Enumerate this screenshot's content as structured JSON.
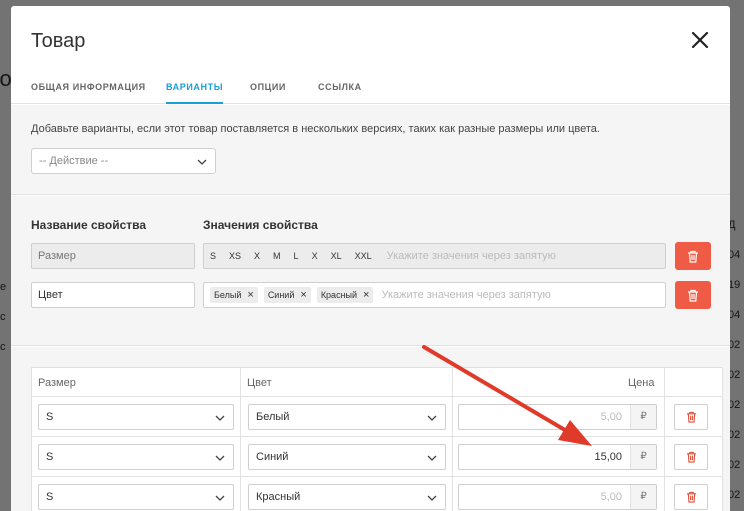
{
  "background": {
    "header_fragment": "го",
    "right_fragments": [
      "Д",
      "04",
      "19",
      "04",
      "02",
      "02",
      "02",
      "02",
      "02",
      "02"
    ],
    "left_fragments": [
      "е",
      "с",
      "с"
    ]
  },
  "modal": {
    "title": "Товар",
    "tabs": [
      {
        "label": "ОБЩАЯ ИНФОРМАЦИЯ",
        "active": false
      },
      {
        "label": "ВАРИАНТЫ",
        "active": true
      },
      {
        "label": "ОПЦИИ",
        "active": false
      },
      {
        "label": "ССЫЛКА",
        "active": false
      }
    ],
    "hint": "Добавьте варианты, если этот товар поставляется в нескольких версиях, таких как разные размеры или цвета.",
    "action_select": "-- Действие --",
    "properties": {
      "name_header": "Название свойства",
      "values_header": "Значения свойства",
      "values_placeholder": "Укажите значения через запятую",
      "rows": [
        {
          "name": "Размер",
          "disabled": true,
          "values": [
            "S",
            "XS",
            "X",
            "M",
            "L",
            "X",
            "XL",
            "XXL"
          ]
        },
        {
          "name": "Цвет",
          "disabled": false,
          "values": [
            "Белый",
            "Синий",
            "Красный"
          ]
        }
      ]
    },
    "variants": {
      "headers": {
        "size": "Размер",
        "color": "Цвет",
        "price": "Цена"
      },
      "currency": "₽",
      "rows": [
        {
          "size": "S",
          "color": "Белый",
          "price": "5,00",
          "price_is_placeholder": true
        },
        {
          "size": "S",
          "color": "Синий",
          "price": "15,00",
          "price_is_placeholder": false
        },
        {
          "size": "S",
          "color": "Красный",
          "price": "5,00",
          "price_is_placeholder": true
        }
      ]
    }
  },
  "colors": {
    "accent": "#1a9fd6",
    "danger": "#ef5b45",
    "trash_icon": "#e0533e",
    "annotation_arrow": "#e03a2b"
  },
  "icons": {
    "close": "close-icon",
    "chevron": "chevron-down-icon",
    "trash": "trash-icon"
  }
}
